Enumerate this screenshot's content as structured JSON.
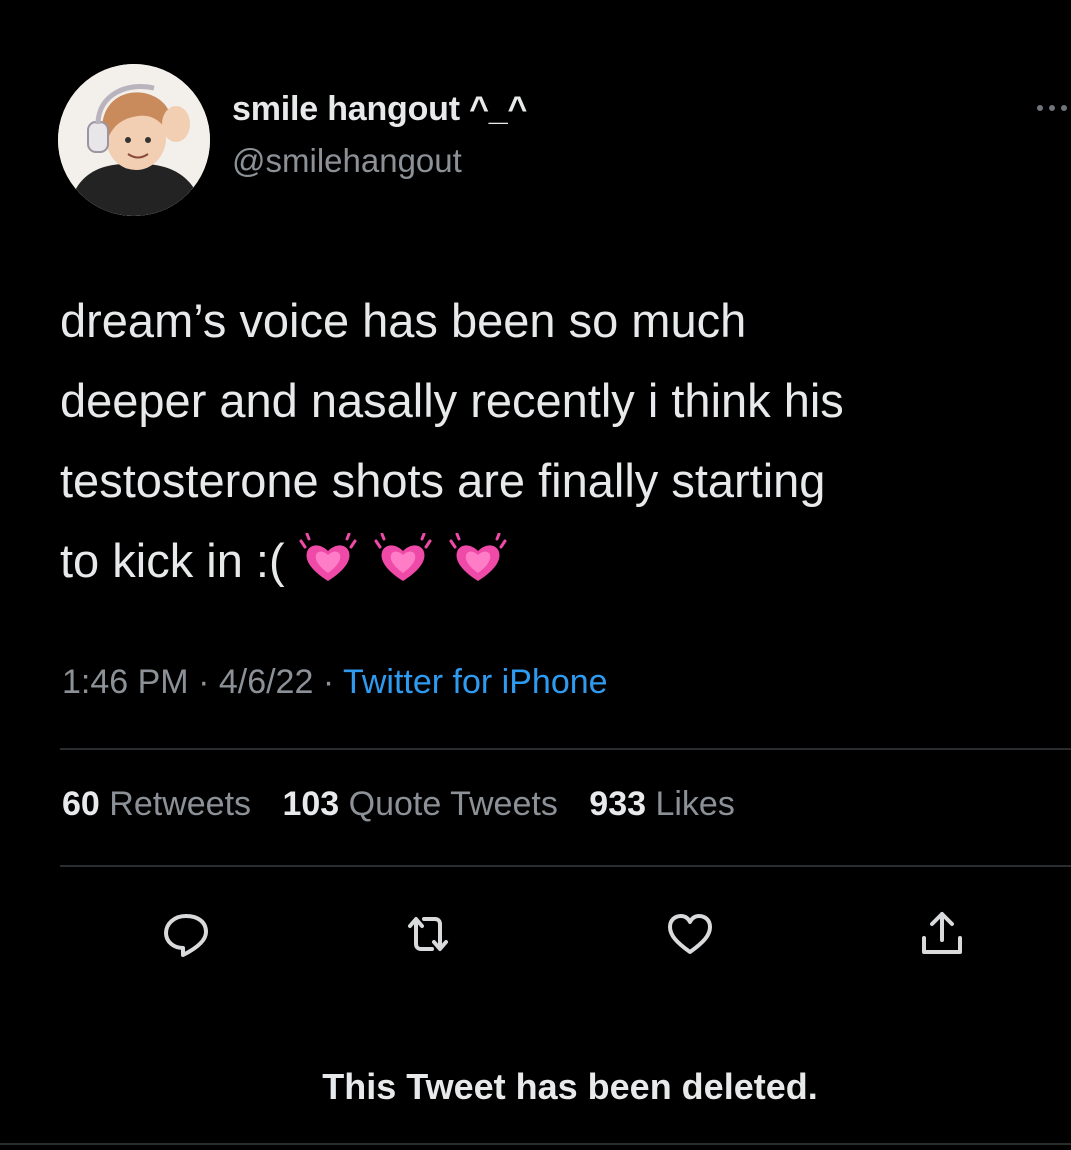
{
  "user": {
    "display_name": "smile hangout ^_^",
    "handle": "@smilehangout"
  },
  "tweet": {
    "text_lines": [
      "dream’s voice has been so much",
      "deeper and nasally recently i think his",
      "testosterone shots are finally starting",
      "to kick in :("
    ],
    "emojis": [
      "growing-heart-emoji",
      "growing-heart-emoji",
      "growing-heart-emoji"
    ]
  },
  "meta": {
    "time": "1:46 PM",
    "separator": " · ",
    "date": "4/6/22",
    "source": "Twitter for iPhone"
  },
  "stats": {
    "retweets_count": "60",
    "retweets_label": "Retweets",
    "quotes_count": "103",
    "quotes_label": "Quote Tweets",
    "likes_count": "933",
    "likes_label": "Likes"
  },
  "actions": [
    "reply-icon",
    "retweet-icon",
    "like-icon",
    "share-icon"
  ],
  "notice": "This Tweet has been deleted.",
  "colors": {
    "background": "#000000",
    "text": "#e7e9ea",
    "secondary": "#8b9196",
    "link": "#2f9bf0",
    "divider": "#2a2d30",
    "heart": "#f04aa8"
  }
}
